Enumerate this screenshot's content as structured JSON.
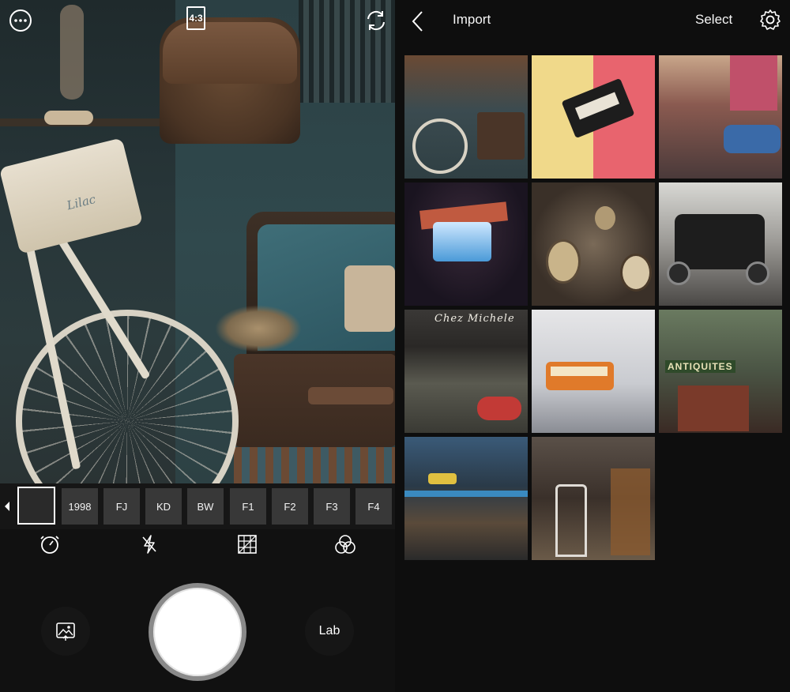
{
  "camera": {
    "ratio_label": "4:3",
    "filters": [
      "1998",
      "FJ",
      "KD",
      "BW",
      "F1",
      "F2",
      "F3",
      "F4"
    ],
    "lab_label": "Lab",
    "viewfinder_texts": {
      "basket_text": "Lilac"
    }
  },
  "import": {
    "title": "Import",
    "select_label": "Select",
    "thumbnails": [
      {
        "caption": ""
      },
      {
        "caption": ""
      },
      {
        "caption": ""
      },
      {
        "caption": ""
      },
      {
        "caption": ""
      },
      {
        "caption": ""
      },
      {
        "caption": "Chez Michele"
      },
      {
        "caption": ""
      },
      {
        "caption": "ANTIQUITES"
      },
      {
        "caption": ""
      },
      {
        "caption": ""
      }
    ]
  },
  "colors": {
    "accent": "#ffffff",
    "chip": "#383838",
    "background": "#0e0e0e"
  }
}
